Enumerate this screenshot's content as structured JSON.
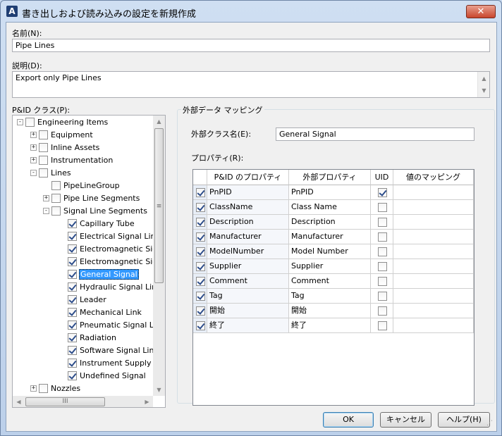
{
  "window": {
    "title": "書き出しおよび読み込みの設定を新規作成",
    "app_icon": "A",
    "close_glyph": "✕"
  },
  "name_field": {
    "label": "名前(N):",
    "value": "Pipe Lines"
  },
  "description_field": {
    "label": "説明(D):",
    "value": "Export only Pipe Lines"
  },
  "pid_class": {
    "label": "P&ID クラス(P):",
    "tree": [
      {
        "label": "Engineering Items",
        "level": 0,
        "expander": "-",
        "checked": false,
        "selected": false
      },
      {
        "label": "Equipment",
        "level": 1,
        "expander": "+",
        "checked": false,
        "selected": false
      },
      {
        "label": "Inline Assets",
        "level": 1,
        "expander": "+",
        "checked": false,
        "selected": false
      },
      {
        "label": "Instrumentation",
        "level": 1,
        "expander": "+",
        "checked": false,
        "selected": false
      },
      {
        "label": "Lines",
        "level": 1,
        "expander": "-",
        "checked": false,
        "selected": false
      },
      {
        "label": "PipeLineGroup",
        "level": 2,
        "expander": "",
        "checked": false,
        "selected": false
      },
      {
        "label": "Pipe Line Segments",
        "level": 2,
        "expander": "+",
        "checked": false,
        "selected": false
      },
      {
        "label": "Signal Line Segments",
        "level": 2,
        "expander": "-",
        "checked": false,
        "selected": false
      },
      {
        "label": "Capillary Tube",
        "level": 3,
        "expander": "",
        "checked": true,
        "selected": false
      },
      {
        "label": "Electrical Signal Line",
        "level": 3,
        "expander": "",
        "checked": true,
        "selected": false
      },
      {
        "label": "Electromagnetic Signal",
        "level": 3,
        "expander": "",
        "checked": true,
        "selected": false
      },
      {
        "label": "Electromagnetic Signal",
        "level": 3,
        "expander": "",
        "checked": true,
        "selected": false
      },
      {
        "label": "General Signal",
        "level": 3,
        "expander": "",
        "checked": true,
        "selected": true
      },
      {
        "label": "Hydraulic Signal Line",
        "level": 3,
        "expander": "",
        "checked": true,
        "selected": false
      },
      {
        "label": "Leader",
        "level": 3,
        "expander": "",
        "checked": true,
        "selected": false
      },
      {
        "label": "Mechanical Link",
        "level": 3,
        "expander": "",
        "checked": true,
        "selected": false
      },
      {
        "label": "Pneumatic Signal Line",
        "level": 3,
        "expander": "",
        "checked": true,
        "selected": false
      },
      {
        "label": "Radiation",
        "level": 3,
        "expander": "",
        "checked": true,
        "selected": false
      },
      {
        "label": "Software Signal Line",
        "level": 3,
        "expander": "",
        "checked": true,
        "selected": false
      },
      {
        "label": "Instrument Supply",
        "level": 3,
        "expander": "",
        "checked": true,
        "selected": false
      },
      {
        "label": "Undefined Signal",
        "level": 3,
        "expander": "",
        "checked": true,
        "selected": false
      },
      {
        "label": "Nozzles",
        "level": 1,
        "expander": "+",
        "checked": false,
        "selected": false
      }
    ]
  },
  "mapping": {
    "group_title": "外部データ マッピング",
    "external_class_label": "外部クラス名(E):",
    "external_class_value": "General Signal",
    "properties_label": "プロパティ(R):",
    "columns": [
      "P&ID のプロパティ",
      "外部プロパティ",
      "UID",
      "値のマッピング"
    ],
    "rows": [
      {
        "include": true,
        "pid_property": "PnPID",
        "external_property": "PnPID",
        "uid": true,
        "value_mapping": ""
      },
      {
        "include": true,
        "pid_property": "ClassName",
        "external_property": "Class Name",
        "uid": false,
        "value_mapping": ""
      },
      {
        "include": true,
        "pid_property": "Description",
        "external_property": "Description",
        "uid": false,
        "value_mapping": ""
      },
      {
        "include": true,
        "pid_property": "Manufacturer",
        "external_property": "Manufacturer",
        "uid": false,
        "value_mapping": ""
      },
      {
        "include": true,
        "pid_property": "ModelNumber",
        "external_property": "Model Number",
        "uid": false,
        "value_mapping": ""
      },
      {
        "include": true,
        "pid_property": "Supplier",
        "external_property": "Supplier",
        "uid": false,
        "value_mapping": ""
      },
      {
        "include": true,
        "pid_property": "Comment",
        "external_property": "Comment",
        "uid": false,
        "value_mapping": ""
      },
      {
        "include": true,
        "pid_property": "Tag",
        "external_property": "Tag",
        "uid": false,
        "value_mapping": ""
      },
      {
        "include": true,
        "pid_property": "開始",
        "external_property": "開始",
        "uid": false,
        "value_mapping": ""
      },
      {
        "include": true,
        "pid_property": "終了",
        "external_property": "終了",
        "uid": false,
        "value_mapping": ""
      }
    ]
  },
  "buttons": {
    "ok": "OK",
    "cancel": "キャンセル",
    "help": "ヘルプ(H)"
  },
  "scroll_glyphs": {
    "up": "▲",
    "down": "▼",
    "left": "◀",
    "right": "▶",
    "grip": "≡",
    "hgrip": "III"
  }
}
